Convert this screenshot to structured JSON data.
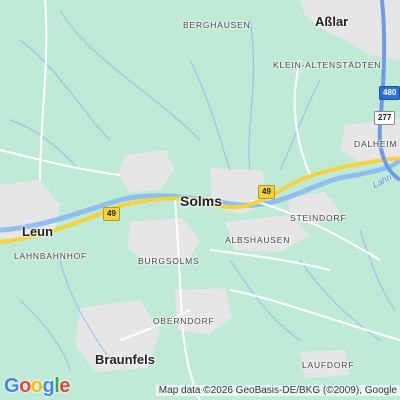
{
  "towns": {
    "asslar": "Aßlar",
    "solms": "Solms",
    "leun": "Leun",
    "braunfels": "Braunfels"
  },
  "villages": {
    "berghausen": "BERGHAUSEN",
    "klein_altenstaedten": "KLEIN-ALTENSTÄDTEN",
    "dalheim": "DALHEIM",
    "steindorf": "STEINDORF",
    "albshausen": "ALBSHAUSEN",
    "lahnbahnhof": "LAHNBAHNHOF",
    "burgsolms": "BURGSOLMS",
    "oberndorf": "OBERNDORF",
    "laufdorf": "LAUFDORF"
  },
  "river": "Lahn",
  "shields": {
    "b49_east": "49",
    "b49_west": "49",
    "b277": "277",
    "a480": "480"
  },
  "logo": [
    "G",
    "o",
    "o",
    "g",
    "l",
    "e"
  ],
  "logo_colors": [
    "#4285F4",
    "#EA4335",
    "#FBBC05",
    "#4285F4",
    "#34A853",
    "#EA4335"
  ],
  "attribution": "Map data ©2026 GeoBasis-DE/BKG (©2009), Google",
  "colors": {
    "land": "#bfead6",
    "urban": "#e4e4e4",
    "water": "#8fbef0",
    "road": "#ffffff",
    "highway": "#f6d23c"
  }
}
